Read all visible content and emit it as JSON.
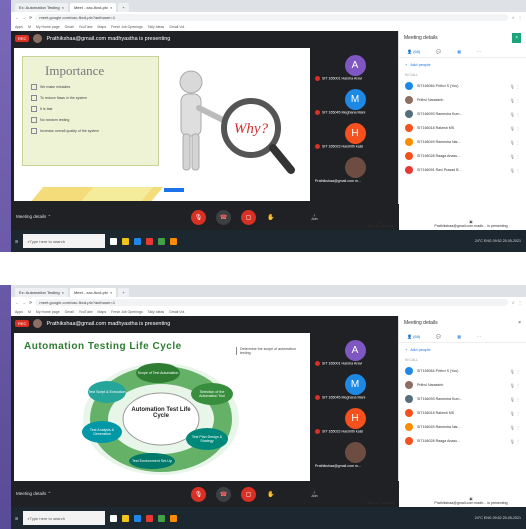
{
  "browser": {
    "tabs": [
      "Ex: Automation Testing",
      "Meet - xac-fkxd-ptx"
    ],
    "url": "meet.google.com/xac-fkxd-ptx?authuser=1",
    "bookmarks": [
      "Apps",
      "M",
      "My Home page",
      "Gmail",
      "YouTube",
      "Maps",
      "Fresh Job Openings",
      "Tally Ideas",
      "Gmail Vol."
    ]
  },
  "meet": {
    "rec": "REC",
    "presenter": "Prathikshaa@gmail.com madhyastha is presenting",
    "meeting_details": "Meeting details",
    "join_label": "Join",
    "present_label": "Present now",
    "turn_on_captions": "Turn on captions",
    "presenter_label": "Prathikshaa@gmail.com madh... is presenting"
  },
  "slide1": {
    "title": "Importance",
    "items": [
      "We make mistakes",
      "To reduce flaws in the system",
      "It is fast",
      "No random testing",
      "Increase overall quality of the system"
    ],
    "question": "Why?"
  },
  "slide2": {
    "title": "Automation Testing Life Cycle",
    "side_note": "Determine the scope of automation testing",
    "center": "Automation Test Life Cycle",
    "nodes": [
      "Scope of Test Automation",
      "Selection of the Automation Tool",
      "Test Plan Design & Strategy",
      "Test Environment Set-Up",
      "Test Script & Execution",
      "Test Analysis & Generation"
    ]
  },
  "tiles": [
    {
      "letter": "A",
      "color": "#7e57c2",
      "name": "SIT 165001 Harsha Aravi"
    },
    {
      "letter": "M",
      "color": "#1e88e5",
      "name": "SIT 165045 Meghana Mani"
    },
    {
      "letter": "H",
      "color": "#f4511e",
      "name": "SIT 165023 Harshith kalsi"
    },
    {
      "letter": "",
      "color": "#6d4c41",
      "name": "Prathikshaa@gmail.com m..."
    }
  ],
  "people": {
    "header": "Meeting details",
    "tab_people": "(68)",
    "add_people": "Add people",
    "section": "IN CALL",
    "rows": [
      {
        "name": "SIT165064 Prithvi S (You)",
        "color": "#1e88e5"
      },
      {
        "name": "Prithvi Narasimh",
        "color": "#8d6e63"
      },
      {
        "name": "SIT166093 Ramesha Kum...",
        "color": "#546e7a"
      },
      {
        "name": "SIT166018 Rakesh MS",
        "color": "#f4511e"
      },
      {
        "name": "SIT166049 Ramesha Nar...",
        "color": "#fb8c00"
      },
      {
        "name": "SIT166028 Raaga Anasu...",
        "color": "#f4511e"
      },
      {
        "name": "SIT166091 Ravi Prasad B...",
        "color": "#e53935"
      }
    ]
  },
  "taskbar": {
    "search": "Type here to search",
    "time": "09:52",
    "date": "25-05-2021",
    "tray": "24°C  ENG"
  },
  "colors": {
    "meet_bg": "#202124",
    "accent": "#1a73e8",
    "red": "#d93025"
  }
}
